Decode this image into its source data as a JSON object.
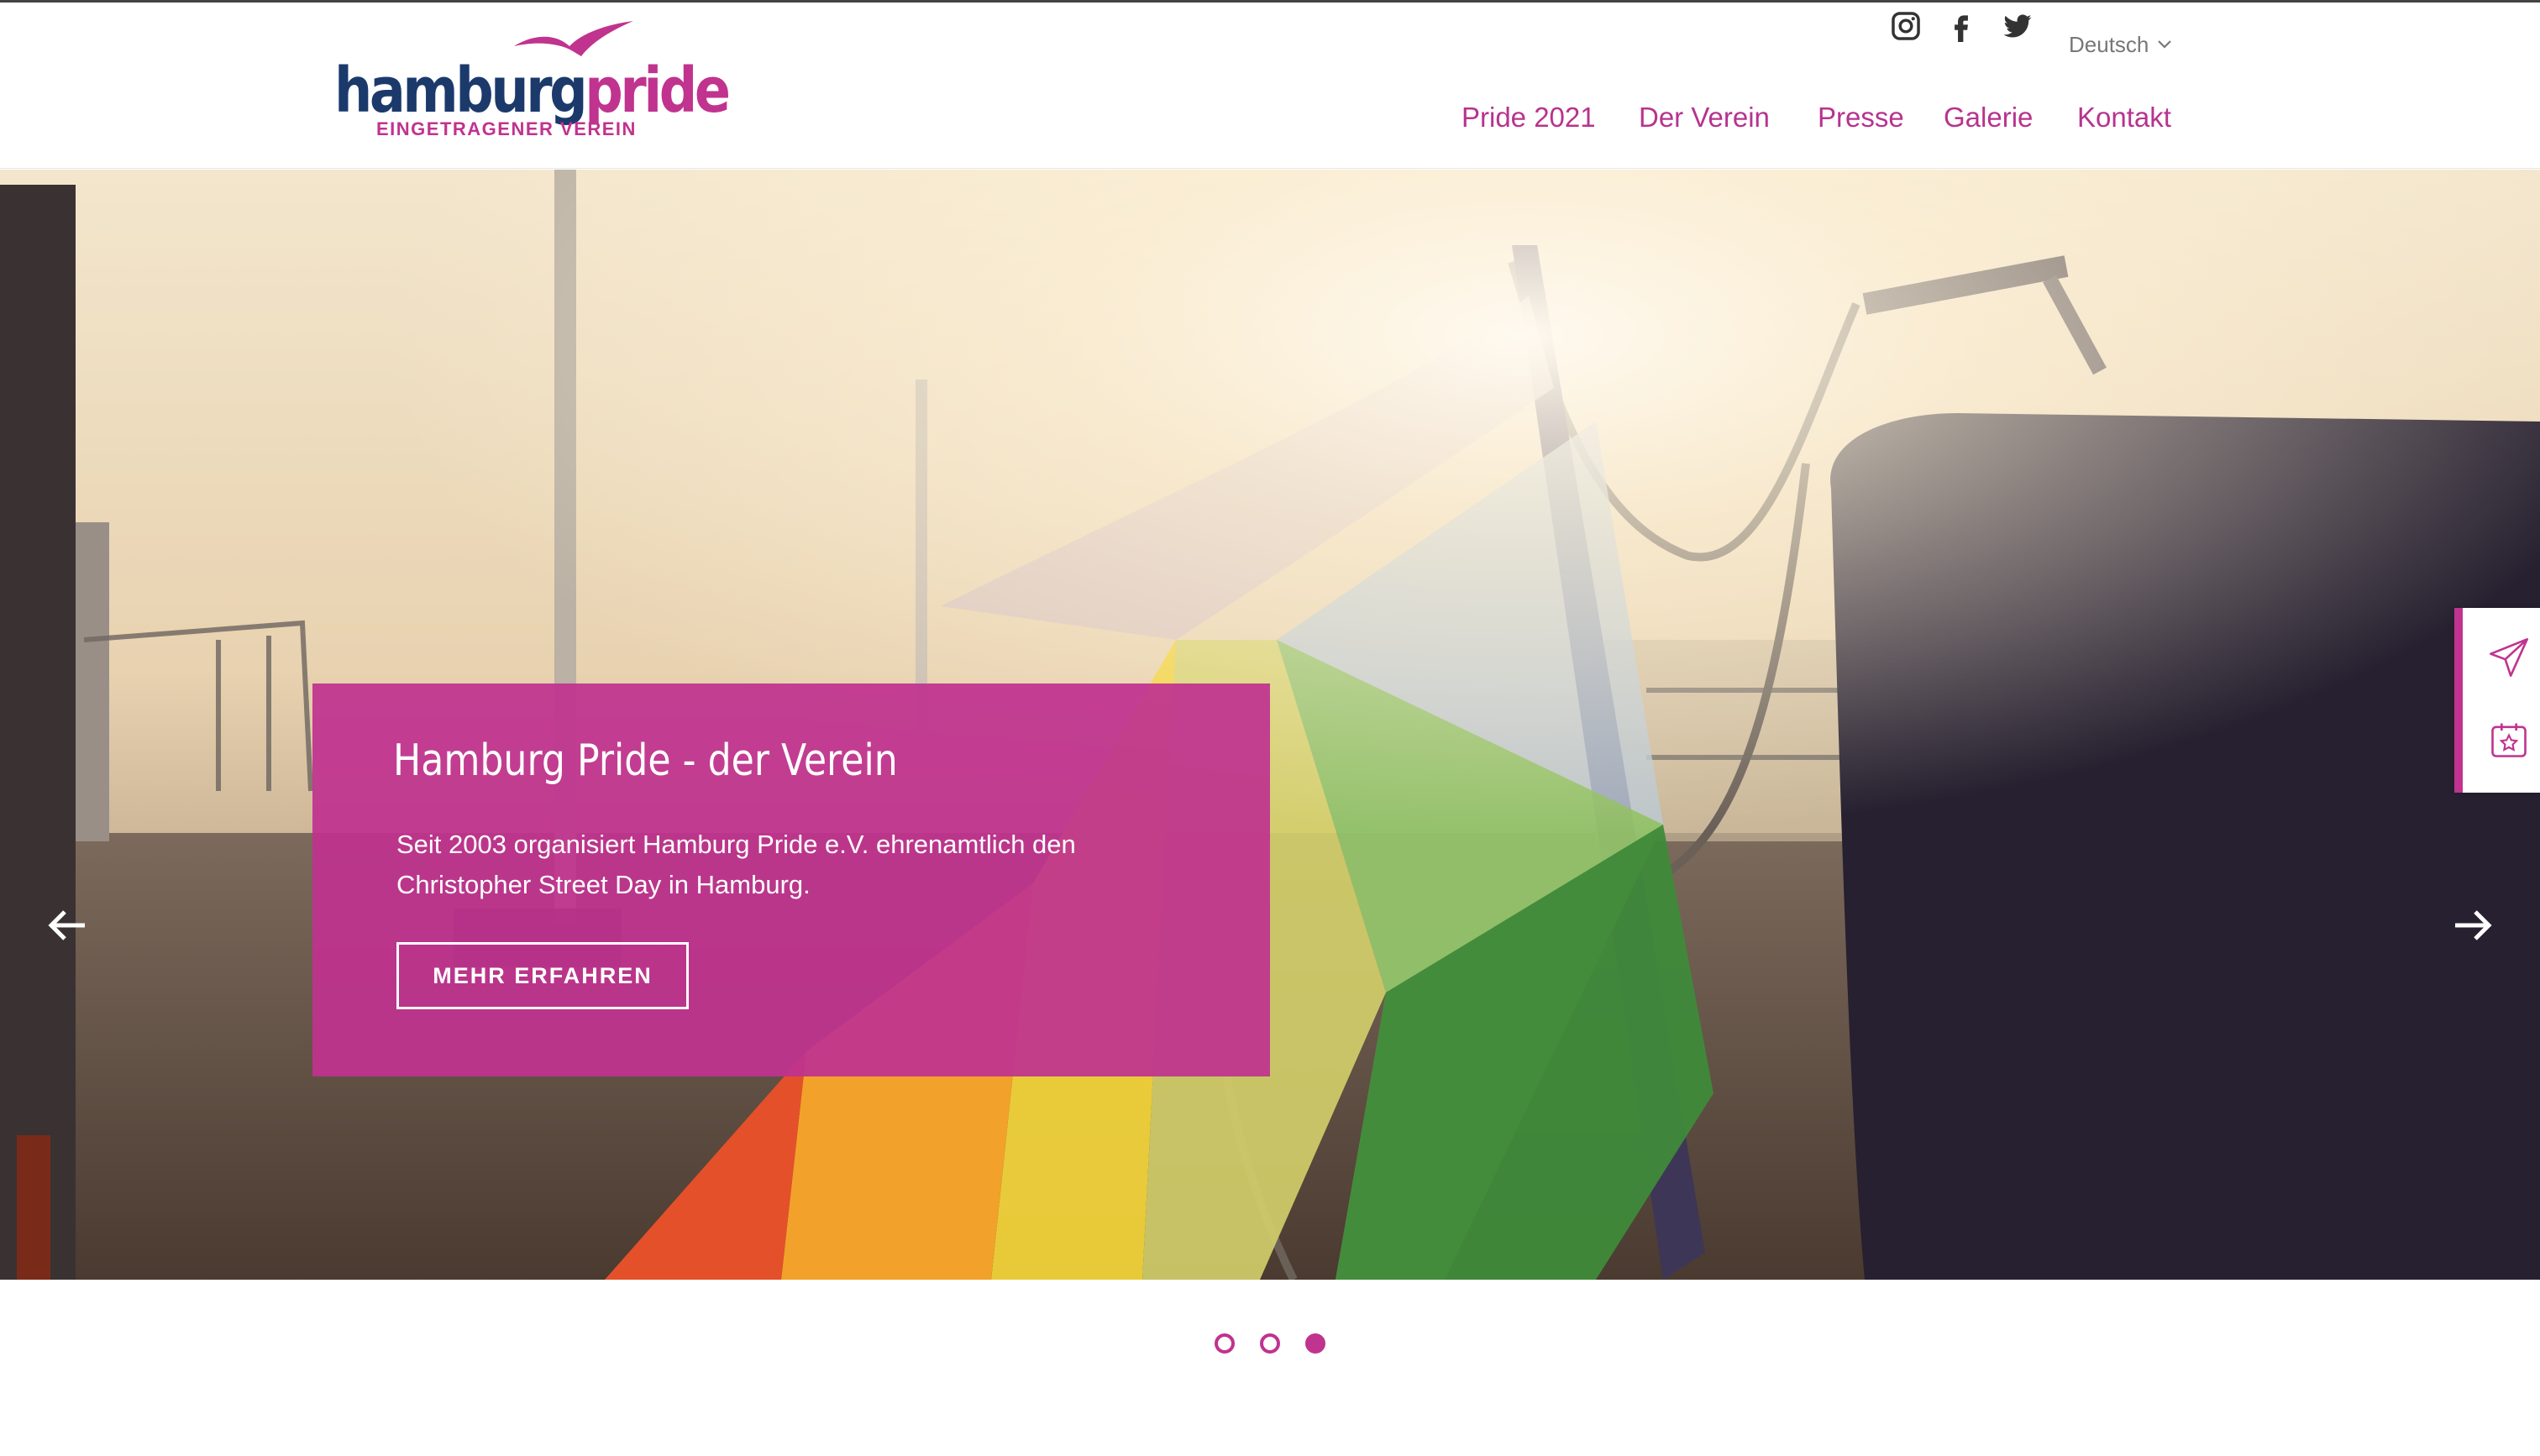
{
  "header": {
    "logo": {
      "word_primary": "hamburg",
      "word_accent": "pride",
      "subtitle": "EINGETRAGENER VEREIN",
      "icon": "seagull-icon"
    },
    "social": [
      {
        "name": "instagram",
        "icon": "instagram-icon"
      },
      {
        "name": "facebook",
        "icon": "facebook-icon"
      },
      {
        "name": "twitter",
        "icon": "twitter-icon"
      }
    ],
    "language": {
      "selected": "Deutsch",
      "icon": "chevron-down-icon"
    },
    "nav": [
      {
        "label": "Pride 2021"
      },
      {
        "label": "Der Verein"
      },
      {
        "label": "Presse"
      },
      {
        "label": "Galerie"
      },
      {
        "label": "Kontakt"
      }
    ]
  },
  "hero": {
    "title": "Hamburg Pride - der Verein",
    "text": "Seit 2003 organisiert Hamburg Pride e.V. ehrenamtlich den Christopher Street Day in Hamburg.",
    "button_label": "MEHR ERFAHREN",
    "prev_icon": "arrow-left-icon",
    "next_icon": "arrow-right-icon"
  },
  "side_widget": [
    {
      "icon": "send-icon"
    },
    {
      "icon": "calendar-star-icon"
    }
  ],
  "slider": {
    "count": 3,
    "active_index": 3
  },
  "colors": {
    "accent": "#c0338f",
    "navy": "#1b3a6b"
  }
}
